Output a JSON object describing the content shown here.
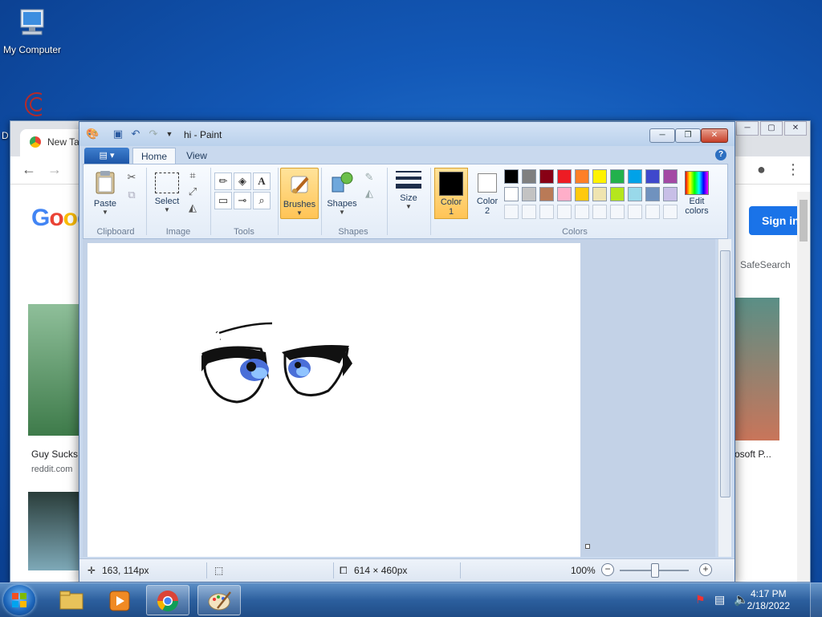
{
  "desktop": {
    "icons": [
      {
        "label": "My Computer"
      },
      {
        "label": "D"
      }
    ]
  },
  "chrome": {
    "tab_title": "New Ta",
    "google_partial": "Goog",
    "signin_label": "Sign in",
    "safesearch_label": "SafeSearch",
    "results": [
      {
        "title": "Guy Sucks",
        "source": "reddit.com"
      },
      {
        "title": "osoft P..."
      }
    ]
  },
  "paint": {
    "window_title": "hi - Paint",
    "tabs": [
      {
        "label": "Home",
        "active": true
      },
      {
        "label": "View",
        "active": false
      }
    ],
    "groups": {
      "clipboard": {
        "label": "Clipboard",
        "paste_label": "Paste"
      },
      "image": {
        "label": "Image",
        "select_label": "Select"
      },
      "tools": {
        "label": "Tools"
      },
      "brushes": {
        "label": "Brushes"
      },
      "shapes": {
        "label": "Shapes",
        "shapes_label": "Shapes"
      },
      "size": {
        "label": "Size"
      },
      "colors": {
        "label": "Colors",
        "color1_label": "Color",
        "color1_num": "1",
        "color2_label": "Color",
        "color2_num": "2",
        "edit_colors_label": "Edit",
        "edit_colors_label2": "colors",
        "palette_row1": [
          "#000000",
          "#7f7f7f",
          "#880015",
          "#ed1c24",
          "#ff7f27",
          "#fff200",
          "#22b14c",
          "#00a2e8",
          "#3f48cc",
          "#a349a4"
        ],
        "palette_row2": [
          "#ffffff",
          "#c3c3c3",
          "#b97a57",
          "#ffaec9",
          "#ffc90e",
          "#efe4b0",
          "#b5e61d",
          "#99d9ea",
          "#7092be",
          "#c8bfe7"
        ]
      }
    },
    "status": {
      "cursor_pos": "163, 114px",
      "canvas_size": "614 × 460px",
      "zoom": "100%",
      "zoom_fraction": 0.5
    }
  },
  "taskbar": {
    "time": "4:17 PM",
    "date": "2/18/2022"
  }
}
